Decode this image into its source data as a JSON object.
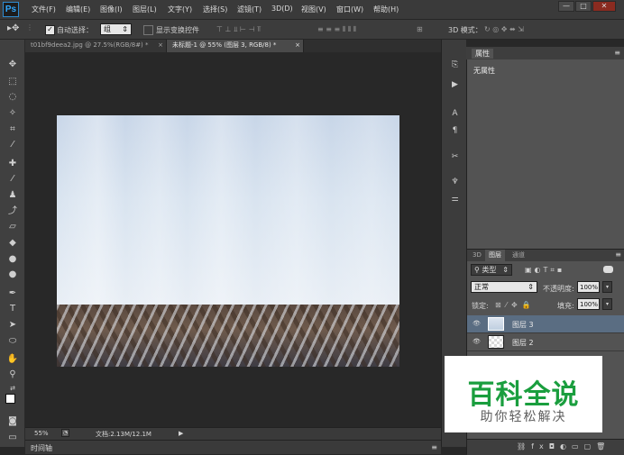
{
  "app": {
    "logo": "Ps",
    "menu": [
      "文件(F)",
      "编辑(E)",
      "图像(I)",
      "图层(L)",
      "文字(Y)",
      "选择(S)",
      "滤镜(T)",
      "3D(D)",
      "视图(V)",
      "窗口(W)",
      "帮助(H)"
    ],
    "window_controls": [
      "—",
      "□",
      "✕"
    ]
  },
  "options": {
    "auto_select_label": "自动选择：",
    "auto_select_value": "组",
    "show_transform_label": "显示变换控件",
    "mode_3d_label": "3D 模式："
  },
  "tabs": [
    {
      "label": "t01bf9deea2.jpg @ 27.5%(RGB/8#) *",
      "close": "×",
      "active": false
    },
    {
      "label": "未标题-1 @ 55% (图层 3, RGB/8) *",
      "close": "×",
      "active": true
    }
  ],
  "status": {
    "zoom": "55%",
    "doc": "文档:2.13M/12.1M",
    "timeline": "时间轴"
  },
  "properties": {
    "title": "属性",
    "empty": "无属性"
  },
  "layers_panel": {
    "tabs": [
      "3D",
      "图层",
      "通道"
    ],
    "filter_kind": "类型",
    "blend_mode": "正常",
    "opacity_label": "不透明度:",
    "opacity_value": "100%",
    "lock_label": "锁定:",
    "fill_label": "填充:",
    "fill_value": "100%",
    "layers": [
      {
        "name": "图层 3",
        "selected": true
      },
      {
        "name": "图层 2",
        "selected": false
      }
    ]
  },
  "watermark": {
    "main": "百科全说",
    "sub": "助你轻松解决"
  },
  "colors": {
    "accent": "#31a8ff",
    "watermark_green": "#1a9e3e",
    "layer_selected": "#5a6d82"
  }
}
